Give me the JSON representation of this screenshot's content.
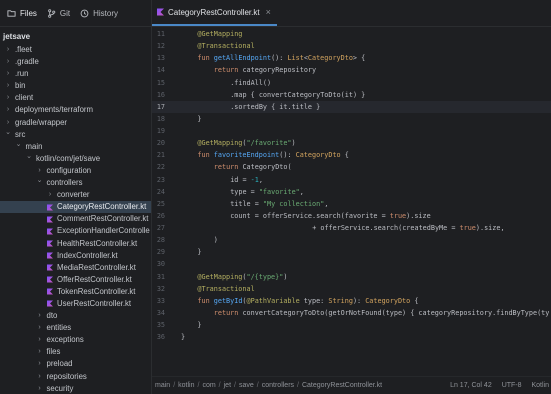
{
  "left_tabs": [
    {
      "label": "Files",
      "icon": "folder-icon",
      "active": true
    },
    {
      "label": "Git",
      "icon": "git-branch-icon",
      "active": false
    },
    {
      "label": "History",
      "icon": "history-icon",
      "active": false
    }
  ],
  "project_name": "jetsave",
  "tree": [
    {
      "label": ".fleet",
      "depth": 0,
      "chevron": "right"
    },
    {
      "label": ".gradle",
      "depth": 0,
      "chevron": "right"
    },
    {
      "label": ".run",
      "depth": 0,
      "chevron": "right"
    },
    {
      "label": "bin",
      "depth": 0,
      "chevron": "right"
    },
    {
      "label": "client",
      "depth": 0,
      "chevron": "right"
    },
    {
      "label": "deployments/terraform",
      "depth": 0,
      "chevron": "right"
    },
    {
      "label": "gradle/wrapper",
      "depth": 0,
      "chevron": "right"
    },
    {
      "label": "src",
      "depth": 0,
      "chevron": "down"
    },
    {
      "label": "main",
      "depth": 1,
      "chevron": "down"
    },
    {
      "label": "kotlin/com/jet/save",
      "depth": 2,
      "chevron": "down"
    },
    {
      "label": "configuration",
      "depth": 3,
      "chevron": "right"
    },
    {
      "label": "controllers",
      "depth": 3,
      "chevron": "down"
    },
    {
      "label": "converter",
      "depth": 4,
      "chevron": "right"
    },
    {
      "label": "CategoryRestController.kt",
      "depth": 4,
      "file": true,
      "selected": true
    },
    {
      "label": "CommentRestController.kt",
      "depth": 4,
      "file": true
    },
    {
      "label": "ExceptionHandlerControlle",
      "depth": 4,
      "file": true
    },
    {
      "label": "HealthRestController.kt",
      "depth": 4,
      "file": true
    },
    {
      "label": "IndexController.kt",
      "depth": 4,
      "file": true
    },
    {
      "label": "MediaRestController.kt",
      "depth": 4,
      "file": true
    },
    {
      "label": "OfferRestController.kt",
      "depth": 4,
      "file": true
    },
    {
      "label": "TokenRestController.kt",
      "depth": 4,
      "file": true
    },
    {
      "label": "UserRestController.kt",
      "depth": 4,
      "file": true
    },
    {
      "label": "dto",
      "depth": 3,
      "chevron": "right"
    },
    {
      "label": "entities",
      "depth": 3,
      "chevron": "right"
    },
    {
      "label": "exceptions",
      "depth": 3,
      "chevron": "right"
    },
    {
      "label": "files",
      "depth": 3,
      "chevron": "right"
    },
    {
      "label": "preload",
      "depth": 3,
      "chevron": "right"
    },
    {
      "label": "repositories",
      "depth": 3,
      "chevron": "right"
    },
    {
      "label": "security",
      "depth": 3,
      "chevron": "right"
    }
  ],
  "editor_tab": {
    "label": "CategoryRestController.kt",
    "close": "×"
  },
  "code": [
    {
      "n": "11",
      "indent": 1,
      "tokens": [
        [
          "an",
          "@GetMapping"
        ]
      ]
    },
    {
      "n": "12",
      "indent": 1,
      "tokens": [
        [
          "an",
          "@Transactional"
        ]
      ]
    },
    {
      "n": "13",
      "indent": 1,
      "tokens": [
        [
          "kw",
          "fun "
        ],
        [
          "fn",
          "getAllEndpoint"
        ],
        [
          "pl",
          "(): "
        ],
        [
          "ty",
          "List"
        ],
        [
          "pl",
          "<"
        ],
        [
          "ty",
          "CategoryDto"
        ],
        [
          "pl",
          "> {"
        ]
      ]
    },
    {
      "n": "14",
      "indent": 2,
      "tokens": [
        [
          "kw",
          "return "
        ],
        [
          "pl",
          "categoryRepository"
        ]
      ]
    },
    {
      "n": "15",
      "indent": 3,
      "tokens": [
        [
          "pl",
          ".findAll()"
        ]
      ]
    },
    {
      "n": "16",
      "indent": 3,
      "tokens": [
        [
          "pl",
          ".map { convertCategoryToDto(it) }"
        ]
      ]
    },
    {
      "n": "17",
      "indent": 3,
      "current": true,
      "tokens": [
        [
          "pl",
          ".sortedBy { it.title }"
        ]
      ]
    },
    {
      "n": "18",
      "indent": 1,
      "tokens": [
        [
          "pl",
          "}"
        ]
      ]
    },
    {
      "n": "19",
      "indent": 0,
      "tokens": []
    },
    {
      "n": "20",
      "indent": 1,
      "tokens": [
        [
          "an",
          "@GetMapping"
        ],
        [
          "pl",
          "("
        ],
        [
          "str",
          "\"/favorite\""
        ],
        [
          "pl",
          ")"
        ]
      ]
    },
    {
      "n": "21",
      "indent": 1,
      "tokens": [
        [
          "kw",
          "fun "
        ],
        [
          "fn",
          "favoriteEndpoint"
        ],
        [
          "pl",
          "(): "
        ],
        [
          "ty",
          "CategoryDto"
        ],
        [
          "pl",
          " {"
        ]
      ]
    },
    {
      "n": "22",
      "indent": 2,
      "tokens": [
        [
          "kw",
          "return "
        ],
        [
          "pl",
          "CategoryDto("
        ]
      ]
    },
    {
      "n": "23",
      "indent": 3,
      "tokens": [
        [
          "pl",
          "id = "
        ],
        [
          "num",
          "-1"
        ],
        [
          "pl",
          ","
        ]
      ]
    },
    {
      "n": "24",
      "indent": 3,
      "tokens": [
        [
          "pl",
          "type = "
        ],
        [
          "str",
          "\"favorite\""
        ],
        [
          "pl",
          ","
        ]
      ]
    },
    {
      "n": "25",
      "indent": 3,
      "tokens": [
        [
          "pl",
          "title = "
        ],
        [
          "str",
          "\"My collection\""
        ],
        [
          "pl",
          ","
        ]
      ]
    },
    {
      "n": "26",
      "indent": 3,
      "tokens": [
        [
          "pl",
          "count = offerService.search(favorite = "
        ],
        [
          "kw",
          "true"
        ],
        [
          "pl",
          ").size"
        ]
      ]
    },
    {
      "n": "27",
      "indent": 8,
      "tokens": [
        [
          "pl",
          "+ offerService.search(createdByMe = "
        ],
        [
          "kw",
          "true"
        ],
        [
          "pl",
          ").size,"
        ]
      ]
    },
    {
      "n": "28",
      "indent": 2,
      "tokens": [
        [
          "pl",
          ")"
        ]
      ]
    },
    {
      "n": "29",
      "indent": 1,
      "tokens": [
        [
          "pl",
          "}"
        ]
      ]
    },
    {
      "n": "30",
      "indent": 0,
      "tokens": []
    },
    {
      "n": "31",
      "indent": 1,
      "tokens": [
        [
          "an",
          "@GetMapping"
        ],
        [
          "pl",
          "("
        ],
        [
          "str",
          "\"/{type}\""
        ],
        [
          "pl",
          ")"
        ]
      ]
    },
    {
      "n": "32",
      "indent": 1,
      "tokens": [
        [
          "an",
          "@Transactional"
        ]
      ]
    },
    {
      "n": "33",
      "indent": 1,
      "tokens": [
        [
          "kw",
          "fun "
        ],
        [
          "fn",
          "getById"
        ],
        [
          "pl",
          "("
        ],
        [
          "an",
          "@PathVariable"
        ],
        [
          "pl",
          " type: "
        ],
        [
          "ty",
          "String"
        ],
        [
          "pl",
          "): "
        ],
        [
          "ty",
          "CategoryDto"
        ],
        [
          "pl",
          " {"
        ]
      ]
    },
    {
      "n": "34",
      "indent": 2,
      "tokens": [
        [
          "kw",
          "return "
        ],
        [
          "pl",
          "convertCategoryToDto(getOrNotFound(type) { categoryRepository.findByType(ty"
        ]
      ]
    },
    {
      "n": "35",
      "indent": 1,
      "tokens": [
        [
          "pl",
          "}"
        ]
      ]
    },
    {
      "n": "36",
      "indent": 0,
      "tokens": [
        [
          "pl",
          "}"
        ]
      ]
    }
  ],
  "breadcrumb": [
    "main",
    "kotlin",
    "com",
    "jet",
    "save",
    "controllers",
    "CategoryRestController.kt"
  ],
  "status": {
    "position": "Ln 17, Col 42",
    "encoding": "UTF-8",
    "language": "Kotlin"
  },
  "colors": {
    "background": "#1e1f22",
    "selection": "#34414f",
    "accent": "#4a88c7",
    "kotlin_icon_top": "#7f52ff",
    "kotlin_icon_bottom": "#c757bc"
  }
}
